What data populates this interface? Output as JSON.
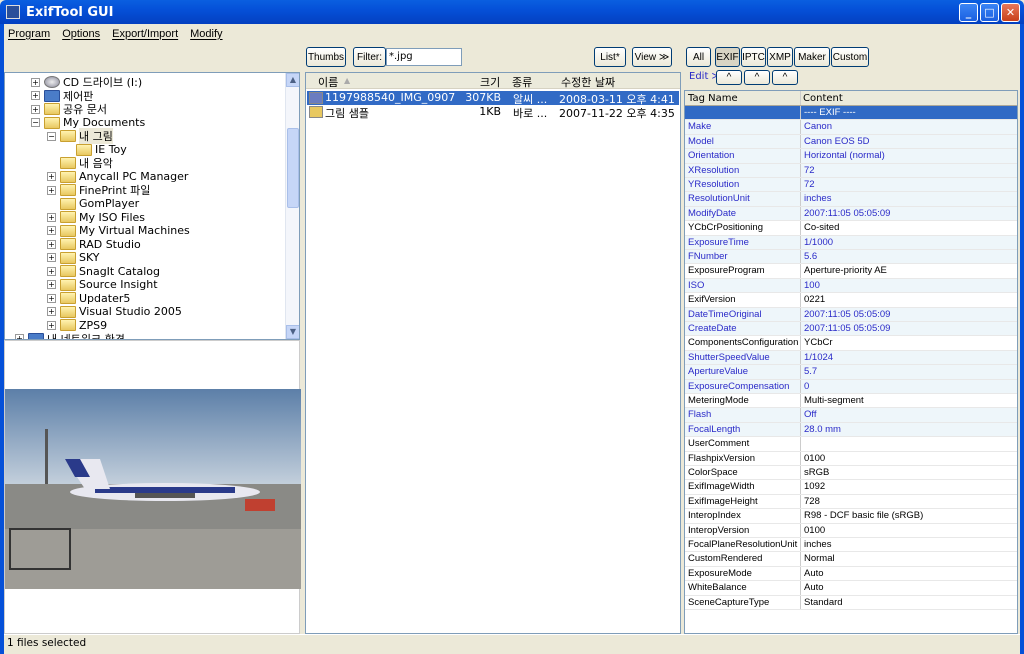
{
  "window": {
    "title": "ExifTool GUI"
  },
  "menu": [
    "Program",
    "Options",
    "Export/Import",
    "Modify"
  ],
  "tree": [
    {
      "label": "CD 드라이브 (I:)",
      "level": 1,
      "pm": "+",
      "icon": "cd-drive"
    },
    {
      "label": "제어판",
      "level": 1,
      "pm": "+",
      "icon": "control-panel"
    },
    {
      "label": "공유 문서",
      "level": 1,
      "pm": "+",
      "icon": "folder"
    },
    {
      "label": "My Documents",
      "level": 1,
      "pm": "-",
      "icon": "folder"
    },
    {
      "label": "내 그림",
      "level": 2,
      "pm": "-",
      "icon": "pictures-folder",
      "selected": true
    },
    {
      "label": "IE Toy",
      "level": 3,
      "pm": "",
      "icon": "folder"
    },
    {
      "label": "내 음악",
      "level": 2,
      "pm": "",
      "icon": "music-folder"
    },
    {
      "label": "Anycall PC Manager",
      "level": 2,
      "pm": "+",
      "icon": "folder"
    },
    {
      "label": "FinePrint 파일",
      "level": 2,
      "pm": "+",
      "icon": "folder"
    },
    {
      "label": "GomPlayer",
      "level": 2,
      "pm": "",
      "icon": "folder"
    },
    {
      "label": "My ISO Files",
      "level": 2,
      "pm": "+",
      "icon": "folder"
    },
    {
      "label": "My Virtual Machines",
      "level": 2,
      "pm": "+",
      "icon": "folder"
    },
    {
      "label": "RAD Studio",
      "level": 2,
      "pm": "+",
      "icon": "folder"
    },
    {
      "label": "SKY",
      "level": 2,
      "pm": "+",
      "icon": "folder"
    },
    {
      "label": "SnagIt Catalog",
      "level": 2,
      "pm": "+",
      "icon": "folder"
    },
    {
      "label": "Source Insight",
      "level": 2,
      "pm": "+",
      "icon": "folder"
    },
    {
      "label": "Updater5",
      "level": 2,
      "pm": "+",
      "icon": "folder"
    },
    {
      "label": "Visual Studio 2005",
      "level": 2,
      "pm": "+",
      "icon": "folder"
    },
    {
      "label": "ZPS9",
      "level": 2,
      "pm": "+",
      "icon": "folder"
    },
    {
      "label": "내 네트워크 환경",
      "level": 0,
      "pm": "+",
      "icon": "network"
    }
  ],
  "toolbar": {
    "thumbs": "Thumbs",
    "filter_label": "Filter:",
    "filter_value": "*.jpg",
    "list": "List*",
    "view": "View ≫"
  },
  "files": {
    "columns": [
      "이름",
      "크기",
      "종류",
      "수정한 날짜"
    ],
    "rows": [
      {
        "name": "1197988540_IMG_0907",
        "size": "307KB",
        "type": "알씨 ...",
        "date": "2008-03-11 오후 4:41",
        "selected": true
      },
      {
        "name": "그림 샘플",
        "size": "1KB",
        "type": "바로 ...",
        "date": "2007-11-22 오후 4:35",
        "selected": false
      }
    ]
  },
  "tagbar": {
    "buttons": [
      "All",
      "EXIF",
      "IPTC",
      "XMP",
      "Maker",
      "Custom"
    ],
    "active": "EXIF",
    "edit": "Edit ≫",
    "arrows": [
      "^",
      "^",
      "^"
    ]
  },
  "tags": {
    "columns": [
      "Tag Name",
      "Content"
    ],
    "rows": [
      [
        "",
        "---- EXIF ----",
        "s"
      ],
      [
        "Make",
        "Canon",
        "b"
      ],
      [
        "Model",
        "Canon EOS 5D",
        "b"
      ],
      [
        "Orientation",
        "Horizontal (normal)",
        "b"
      ],
      [
        "XResolution",
        "72",
        "b"
      ],
      [
        "YResolution",
        "72",
        "b"
      ],
      [
        "ResolutionUnit",
        "inches",
        "b"
      ],
      [
        "ModifyDate",
        "2007:11:05 05:05:09",
        "b"
      ],
      [
        "YCbCrPositioning",
        "Co-sited",
        ""
      ],
      [
        "ExposureTime",
        "1/1000",
        "b"
      ],
      [
        "FNumber",
        "5.6",
        "b"
      ],
      [
        "ExposureProgram",
        "Aperture-priority AE",
        ""
      ],
      [
        "ISO",
        "100",
        "b"
      ],
      [
        "ExifVersion",
        "0221",
        ""
      ],
      [
        "DateTimeOriginal",
        "2007:11:05 05:05:09",
        "b"
      ],
      [
        "CreateDate",
        "2007:11:05 05:05:09",
        "b"
      ],
      [
        "ComponentsConfiguration",
        "YCbCr",
        ""
      ],
      [
        "ShutterSpeedValue",
        "1/1024",
        "b"
      ],
      [
        "ApertureValue",
        "5.7",
        "b"
      ],
      [
        "ExposureCompensation",
        "0",
        "b"
      ],
      [
        "MeteringMode",
        "Multi-segment",
        ""
      ],
      [
        "Flash",
        "Off",
        "b"
      ],
      [
        "FocalLength",
        "28.0 mm",
        "b"
      ],
      [
        "UserComment",
        "",
        ""
      ],
      [
        "FlashpixVersion",
        "0100",
        ""
      ],
      [
        "ColorSpace",
        "sRGB",
        ""
      ],
      [
        "ExifImageWidth",
        "1092",
        ""
      ],
      [
        "ExifImageHeight",
        "728",
        ""
      ],
      [
        "InteropIndex",
        "R98 - DCF basic file (sRGB)",
        ""
      ],
      [
        "InteropVersion",
        "0100",
        ""
      ],
      [
        "FocalPlaneResolutionUnit",
        "inches",
        ""
      ],
      [
        "CustomRendered",
        "Normal",
        ""
      ],
      [
        "ExposureMode",
        "Auto",
        ""
      ],
      [
        "WhiteBalance",
        "Auto",
        ""
      ],
      [
        "SceneCaptureType",
        "Standard",
        ""
      ]
    ]
  },
  "status": "1 files selected"
}
